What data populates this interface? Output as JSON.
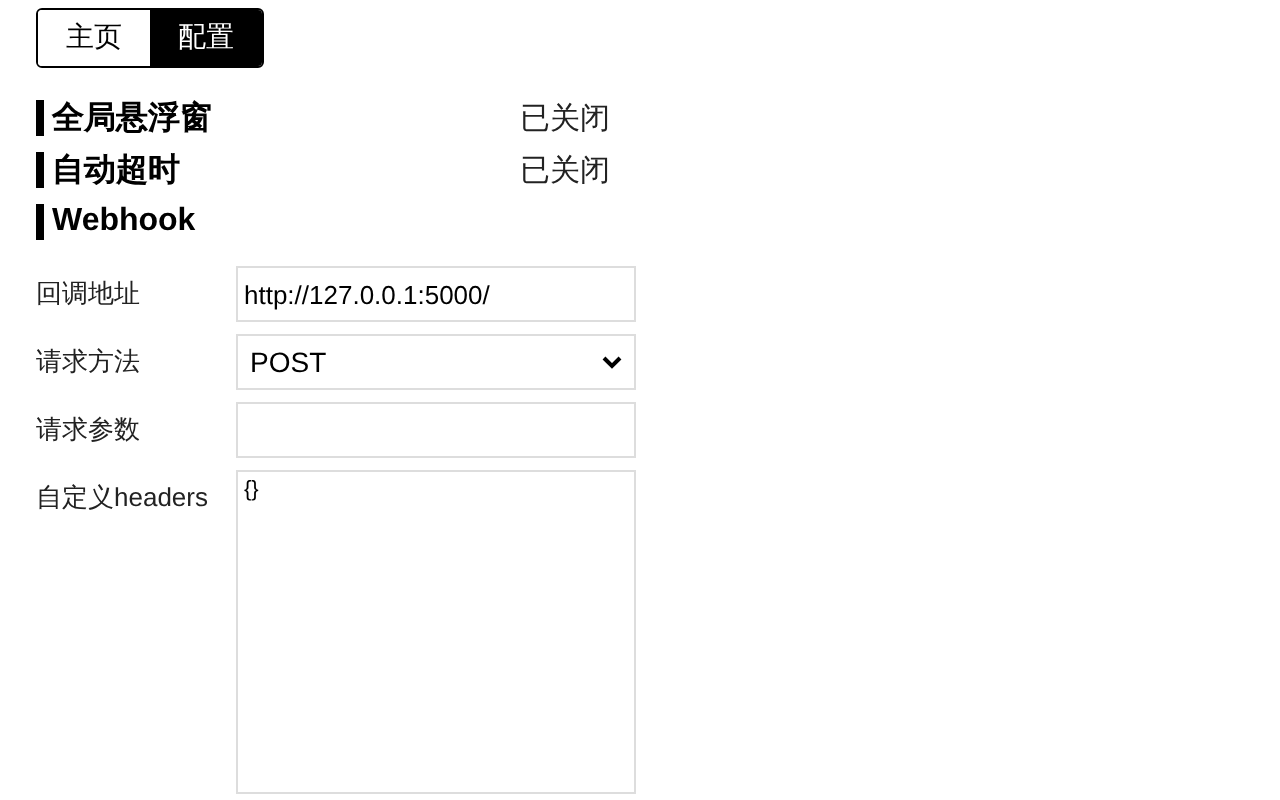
{
  "tabs": [
    {
      "label": "主页",
      "selected": false
    },
    {
      "label": "配置",
      "selected": true
    }
  ],
  "settings": [
    {
      "title": "全局悬浮窗",
      "status": "已关闭"
    },
    {
      "title": "自动超时",
      "status": "已关闭"
    }
  ],
  "webhook": {
    "title": "Webhook",
    "fields": [
      {
        "kind": "text",
        "label": "回调地址",
        "value": "http://127.0.0.1:5000/"
      },
      {
        "kind": "select",
        "label": "请求方法",
        "value": "POST"
      },
      {
        "kind": "text",
        "label": "请求参数"
      },
      {
        "kind": "textarea",
        "label": "自定义headers",
        "value": "{}"
      }
    ]
  }
}
